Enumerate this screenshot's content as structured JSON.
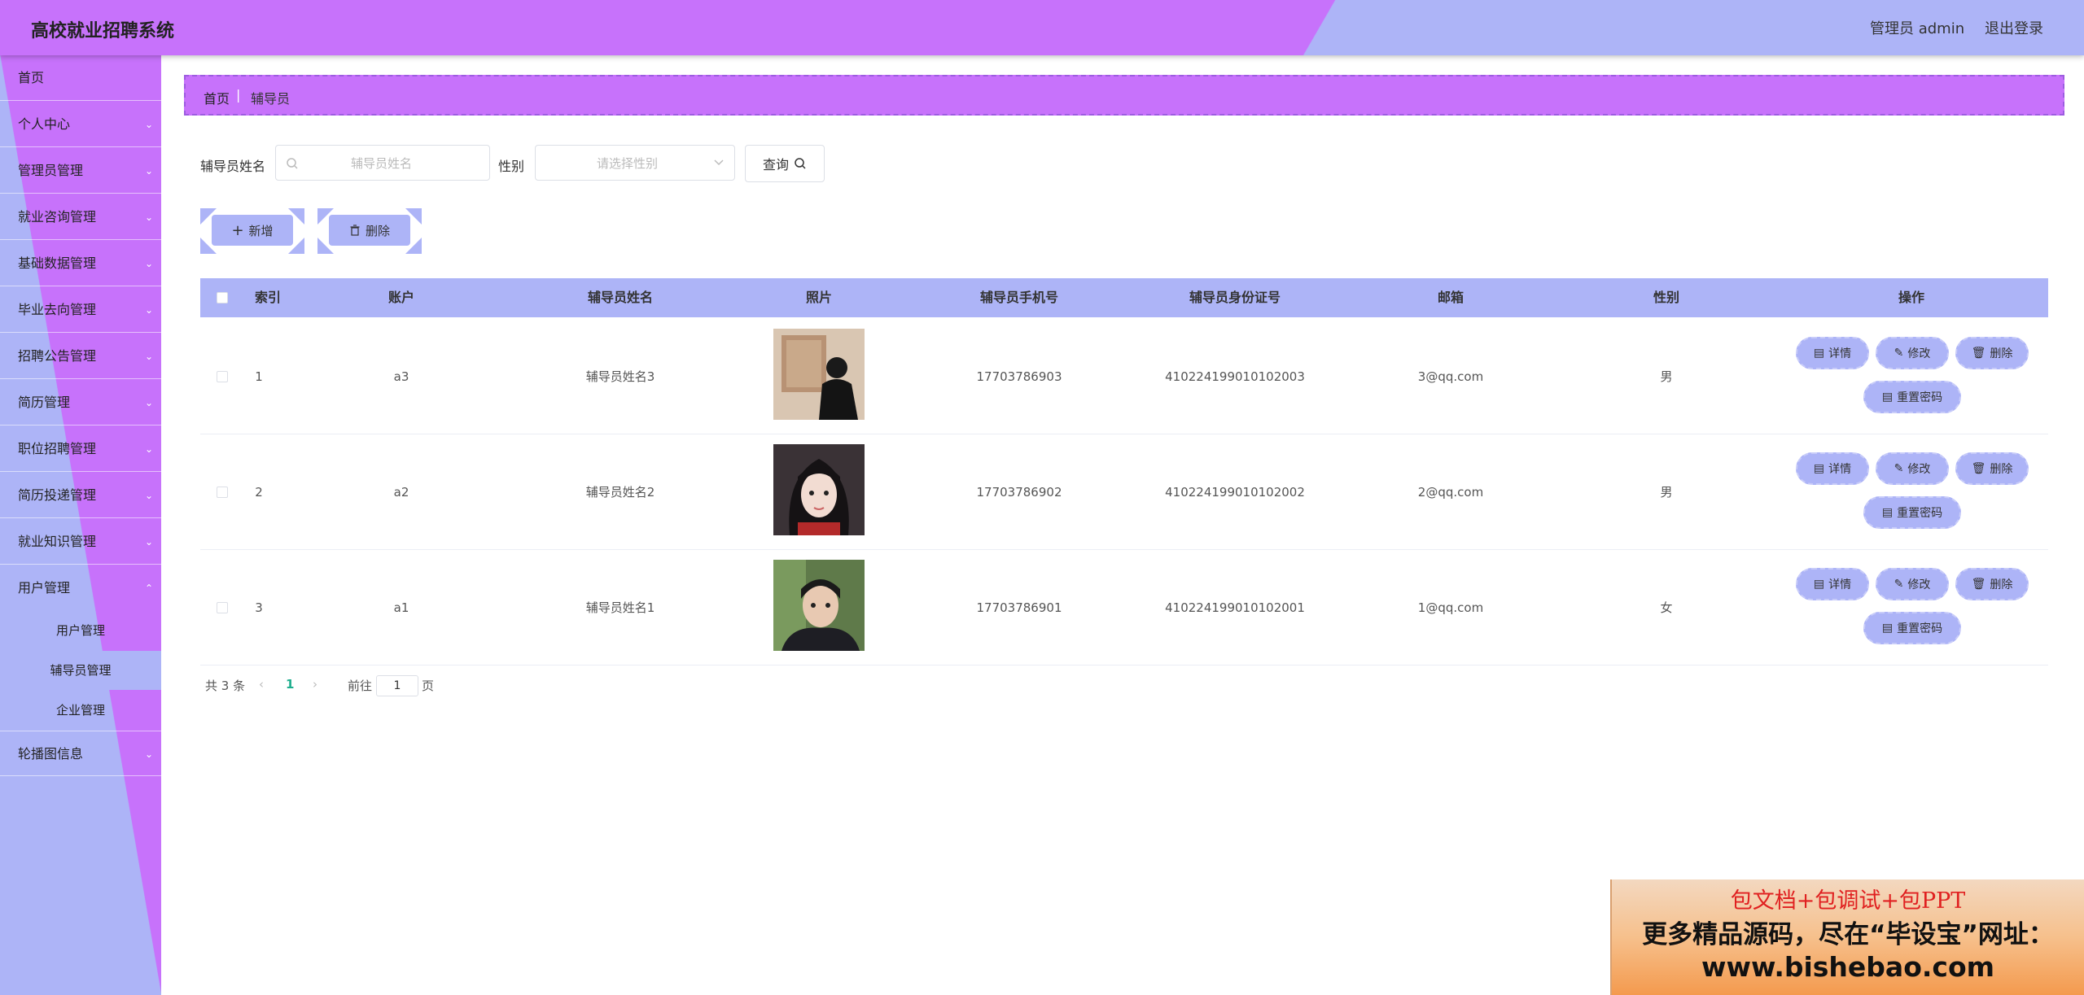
{
  "header": {
    "title": "高校就业招聘系统",
    "admin": "管理员 admin",
    "logout": "退出登录"
  },
  "sidebar": {
    "items": [
      {
        "label": "首页"
      },
      {
        "label": "个人中心"
      },
      {
        "label": "管理员管理"
      },
      {
        "label": "就业咨询管理"
      },
      {
        "label": "基础数据管理"
      },
      {
        "label": "毕业去向管理"
      },
      {
        "label": "招聘公告管理"
      },
      {
        "label": "简历管理"
      },
      {
        "label": "职位招聘管理"
      },
      {
        "label": "简历投递管理"
      },
      {
        "label": "就业知识管理"
      },
      {
        "label": "用户管理"
      },
      {
        "label": "轮播图信息"
      }
    ],
    "sub_items": [
      {
        "label": "用户管理"
      },
      {
        "label": "辅导员管理"
      },
      {
        "label": "企业管理"
      }
    ]
  },
  "breadcrumb": {
    "home": "首页",
    "separator": "|",
    "current": "辅导员"
  },
  "search": {
    "name_label": "辅导员姓名",
    "name_placeholder": "辅导员姓名",
    "gender_label": "性别",
    "gender_placeholder": "请选择性别",
    "query_button": "查询"
  },
  "actions": {
    "add": "新增",
    "delete": "删除"
  },
  "table": {
    "headers": {
      "index": "索引",
      "account": "账户",
      "name": "辅导员姓名",
      "photo": "照片",
      "phone": "辅导员手机号",
      "id_card": "辅导员身份证号",
      "email": "邮箱",
      "gender": "性别",
      "ops": "操作"
    },
    "rows": [
      {
        "index": "1",
        "account": "a3",
        "name": "辅导员姓名3",
        "phone": "17703786903",
        "id_card": "410224199010102003",
        "email": "3@qq.com",
        "gender": "男"
      },
      {
        "index": "2",
        "account": "a2",
        "name": "辅导员姓名2",
        "phone": "17703786902",
        "id_card": "410224199010102002",
        "email": "2@qq.com",
        "gender": "男"
      },
      {
        "index": "3",
        "account": "a1",
        "name": "辅导员姓名1",
        "phone": "17703786901",
        "id_card": "410224199010102001",
        "email": "1@qq.com",
        "gender": "女"
      }
    ],
    "row_buttons": {
      "detail": "详情",
      "edit": "修改",
      "delete": "删除",
      "reset": "重置密码"
    }
  },
  "pagination": {
    "total": "共 3 条",
    "current_page": "1",
    "goto_prefix": "前往",
    "goto_value": "1",
    "goto_suffix": "页"
  },
  "ad": {
    "line1": "包文档+包调试+包PPT",
    "line2": "更多精品源码，尽在“毕设宝”网址：",
    "line3": "www.bishebao.com"
  },
  "colors": {
    "purple": "#c772fb",
    "lavender": "#adb4f7"
  }
}
